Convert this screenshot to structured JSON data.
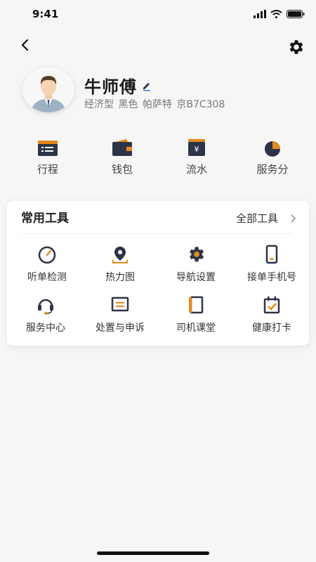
{
  "status_bar": {
    "time": "9:41"
  },
  "profile": {
    "name": "牛师傅",
    "car_info": "经济型 黑色 帕萨特 京B7C308"
  },
  "quick_actions": [
    {
      "label": "行程",
      "icon": "trip-list-icon"
    },
    {
      "label": "钱包",
      "icon": "wallet-icon"
    },
    {
      "label": "流水",
      "icon": "income-flow-icon"
    },
    {
      "label": "服务分",
      "icon": "service-score-icon"
    }
  ],
  "tools_card": {
    "title": "常用工具",
    "all_tools_label": "全部工具",
    "tools": [
      {
        "label": "听单检测",
        "icon": "gauge-icon"
      },
      {
        "label": "热力图",
        "icon": "location-pin-icon"
      },
      {
        "label": "导航设置",
        "icon": "gear-icon"
      },
      {
        "label": "接单手机号",
        "icon": "phone-icon"
      },
      {
        "label": "服务中心",
        "icon": "headset-icon"
      },
      {
        "label": "处置与申诉",
        "icon": "message-icon"
      },
      {
        "label": "司机课堂",
        "icon": "book-icon"
      },
      {
        "label": "健康打卡",
        "icon": "calendar-check-icon"
      }
    ]
  },
  "colors": {
    "accent": "#e58a1f",
    "icon_dark": "#2e3447",
    "background": "#f6f6f7"
  }
}
